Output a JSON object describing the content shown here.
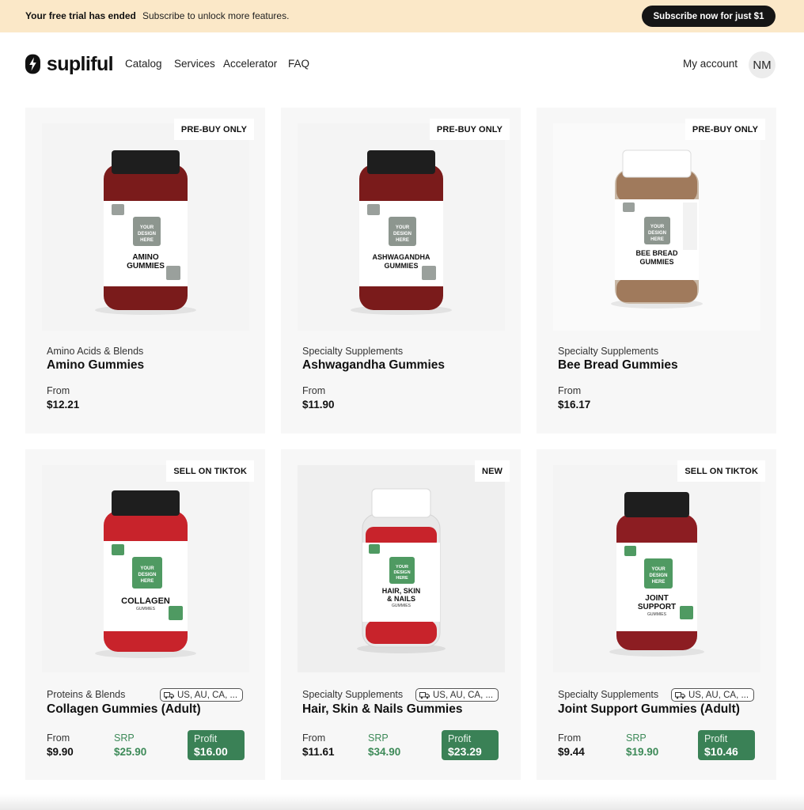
{
  "banner": {
    "title": "Your free trial has ended",
    "subtitle": "Subscribe to unlock more features.",
    "cta": "Subscribe now for just $1"
  },
  "nav": {
    "brand": "supliful",
    "links": [
      "Catalog",
      "Services",
      "Accelerator",
      "FAQ"
    ],
    "account": "My account",
    "avatar_initials": "NM"
  },
  "colors": {
    "banner_bg": "#fbe8c8",
    "accent_green": "#3a8156",
    "srp_green": "#3d8a58"
  },
  "products": [
    {
      "badge": "PRE-BUY ONLY",
      "category": "Amino Acids & Blends",
      "name": "Amino Gummies",
      "from_label": "From",
      "from_price": "$12.21",
      "label_line1": "AMINO",
      "label_line2": "GUMMIES",
      "label_line3": "",
      "design_text": "YOUR DESIGN HERE"
    },
    {
      "badge": "PRE-BUY ONLY",
      "category": "Specialty Supplements",
      "name": "Ashwagandha Gummies",
      "from_label": "From",
      "from_price": "$11.90",
      "label_line1": "ASHWAGANDHA",
      "label_line2": "GUMMIES",
      "label_line3": "",
      "design_text": "YOUR DESIGN HERE"
    },
    {
      "badge": "PRE-BUY ONLY",
      "category": "Specialty Supplements",
      "name": "Bee Bread Gummies",
      "from_label": "From",
      "from_price": "$16.17",
      "label_line1": "BEE BREAD",
      "label_line2": "GUMMIES",
      "label_line3": "",
      "design_text": "YOUR DESIGN HERE"
    },
    {
      "badge": "SELL ON TIKTOK",
      "category": "Proteins & Blends",
      "regions": "US, AU, CA, ...",
      "name": "Collagen Gummies (Adult)",
      "from_label": "From",
      "from_price": "$9.90",
      "srp_label": "SRP",
      "srp_price": "$25.90",
      "profit_label": "Profit",
      "profit_value": "$16.00",
      "label_line1": "COLLAGEN",
      "label_line2": "GUMMIES",
      "label_line3": "",
      "design_text": "YOUR DESIGN HERE"
    },
    {
      "badge": "NEW",
      "category": "Specialty Supplements",
      "regions": "US, AU, CA, ...",
      "name": "Hair, Skin & Nails Gummies",
      "from_label": "From",
      "from_price": "$11.61",
      "srp_label": "SRP",
      "srp_price": "$34.90",
      "profit_label": "Profit",
      "profit_value": "$23.29",
      "label_line1": "HAIR, SKIN",
      "label_line2": "& NAILS",
      "label_line3": "GUMMIES",
      "design_text": "YOUR DESIGN HERE"
    },
    {
      "badge": "SELL ON TIKTOK",
      "category": "Specialty Supplements",
      "regions": "US, AU, CA, ...",
      "name": "Joint Support Gummies (Adult)",
      "from_label": "From",
      "from_price": "$9.44",
      "srp_label": "SRP",
      "srp_price": "$19.90",
      "profit_label": "Profit",
      "profit_value": "$10.46",
      "label_line1": "JOINT",
      "label_line2": "SUPPORT",
      "label_line3": "GUMMIES",
      "design_text": "YOUR DESIGN HERE"
    }
  ]
}
